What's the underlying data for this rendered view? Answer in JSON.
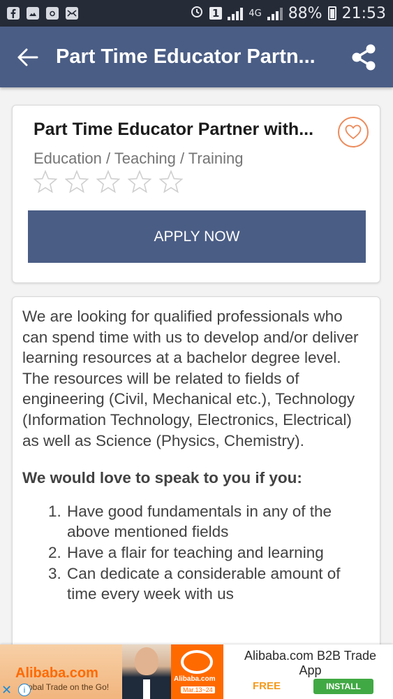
{
  "status_bar": {
    "notification_icons": [
      "facebook-icon",
      "gallery-icon",
      "camera-icon",
      "email-icon"
    ],
    "sim": "1",
    "network": "4G",
    "battery": "88%",
    "time": "21:53"
  },
  "app_bar": {
    "title": "Part Time Educator Partn...",
    "back_icon": "arrow-left-icon",
    "share_icon": "share-icon",
    "color": "#4a5d85"
  },
  "job": {
    "title": "Part Time Educator Partner with...",
    "category": "Education / Teaching / Training",
    "rating": 0,
    "rating_max": 5,
    "apply_label": "APPLY NOW"
  },
  "description": {
    "paragraph1": "We are looking for qualified professionals who can spend time with us to develop and/or deliver learning resources at a bachelor degree level.",
    "paragraph2": "The resources will be related to fields of engineering (Civil, Mechanical etc.), Technology (Information Technology, Electronics, Electrical) as well as Science (Physics, Chemistry).",
    "subheading": "We would love to speak to you if you:",
    "items": [
      "Have good fundamentals in any of the above mentioned fields",
      "Have a flair for teaching and learning",
      "Can dedicate a considerable amount of time every week with us"
    ]
  },
  "ad": {
    "brand": "Alibaba.com",
    "tagline": "Global Trade on the Go!",
    "logo_text": "Alibaba.com",
    "logo_date": "Mar.13~24",
    "headline": "Alibaba.com B2B Trade App",
    "price": "FREE",
    "install_label": "INSTALL"
  }
}
